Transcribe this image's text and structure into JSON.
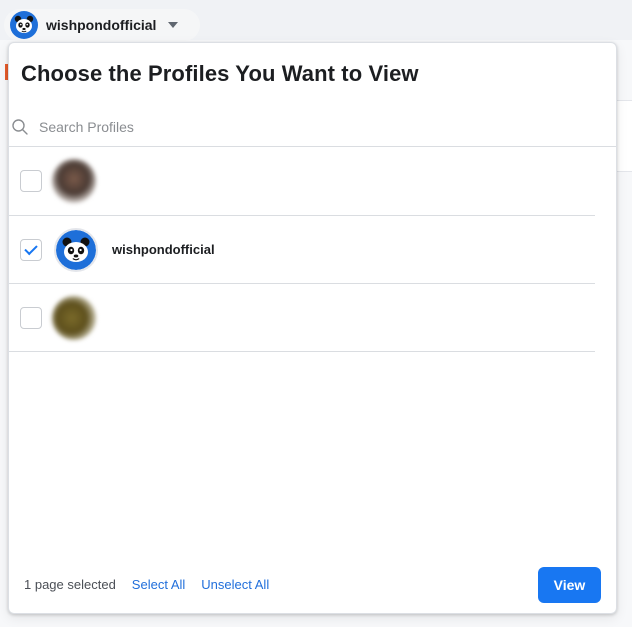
{
  "account_switcher": {
    "name": "wishpondofficial",
    "avatar_icon": "panda-icon",
    "caret_icon": "caret-down-icon"
  },
  "popup": {
    "title": "Choose the Profiles You Want to View",
    "search": {
      "placeholder": "Search Profiles",
      "value": "",
      "icon": "search-icon"
    },
    "profiles": [
      {
        "name": "",
        "checked": false,
        "avatar": "blurred-photo"
      },
      {
        "name": "wishpondofficial",
        "checked": true,
        "avatar": "panda-icon"
      },
      {
        "name": "",
        "checked": false,
        "avatar": "blurred-photo"
      }
    ],
    "footer": {
      "selected_count": "1 page selected",
      "select_all": "Select All",
      "unselect_all": "Unselect All",
      "view": "View"
    }
  },
  "colors": {
    "accent": "#1877f2",
    "link": "#216fdb",
    "panda_bg": "#1e6fd9"
  }
}
